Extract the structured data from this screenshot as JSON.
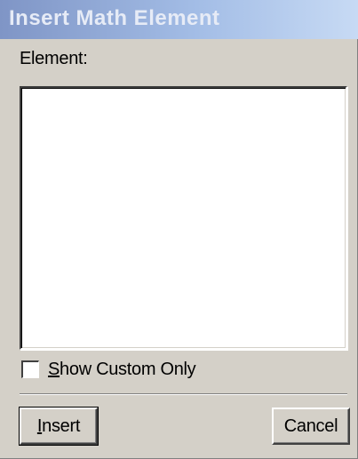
{
  "window": {
    "title": "Insert Math Element"
  },
  "form": {
    "element_label": "Element:",
    "element_list_items": [],
    "show_custom_only_label": "Show Custom Only",
    "show_custom_only_checked": false
  },
  "buttons": {
    "insert_label": "Insert",
    "cancel_label": "Cancel"
  },
  "colors": {
    "dialog_face": "#d4d0c8",
    "titlebar_gradient_start": "#7f95c6",
    "titlebar_gradient_end": "#c7daf4",
    "title_text": "#e6ebf6"
  }
}
